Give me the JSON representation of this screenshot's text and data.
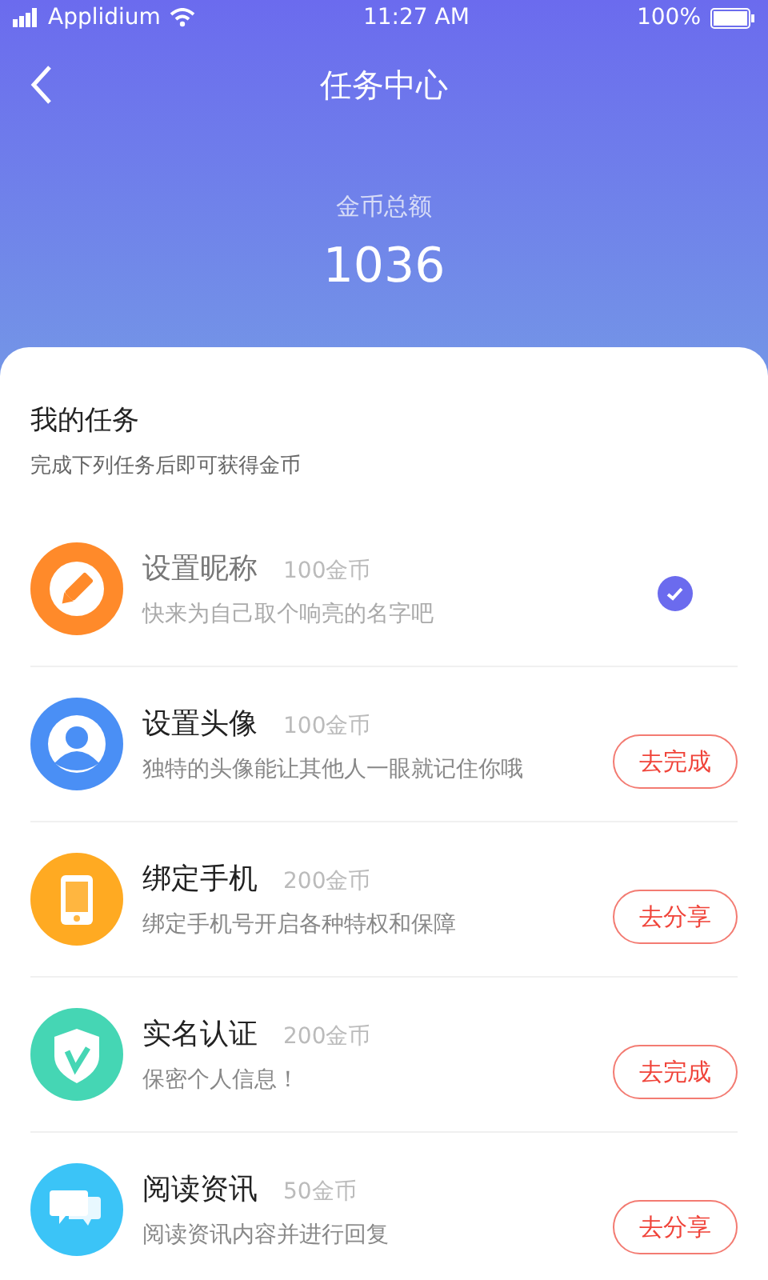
{
  "status_bar": {
    "carrier": "Applidium",
    "time": "11:27 AM",
    "battery": "100%"
  },
  "nav": {
    "title": "任务中心"
  },
  "balance": {
    "label": "金币总额",
    "value": "1036"
  },
  "tasks_section": {
    "title": "我的任务",
    "subtitle": "完成下列任务后即可获得金币"
  },
  "tasks": [
    {
      "kind": "pencil",
      "color": "#ff8a2a",
      "title": "设置昵称",
      "reward": "100金币",
      "description": "快来为自己取个响亮的名字吧",
      "done": true
    },
    {
      "kind": "person",
      "color": "#4a8ff5",
      "title": "设置头像",
      "reward": "100金币",
      "description": "独特的头像能让其他人一眼就记住你哦",
      "done": false,
      "action": "去完成"
    },
    {
      "kind": "phone",
      "color": "#ffaa22",
      "title": "绑定手机",
      "reward": "200金币",
      "description": "绑定手机号开启各种特权和保障",
      "done": false,
      "action": "去分享"
    },
    {
      "kind": "shield",
      "color": "#45d6b4",
      "title": "实名认证",
      "reward": "200金币",
      "description": "保密个人信息！",
      "done": false,
      "action": "去完成"
    },
    {
      "kind": "chat",
      "color": "#3bc4f7",
      "title": "阅读资讯",
      "reward": "50金币",
      "description": "阅读资讯内容并进行回复",
      "done": false,
      "action": "去分享"
    }
  ]
}
